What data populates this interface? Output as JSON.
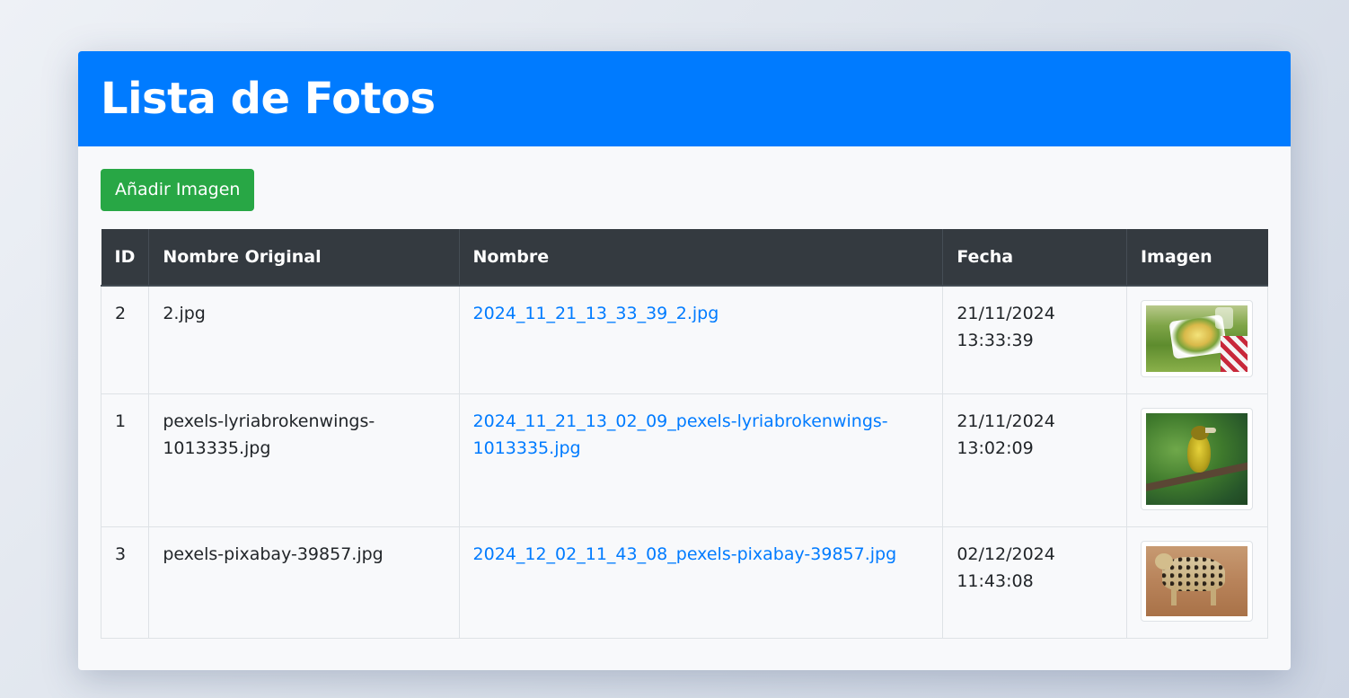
{
  "header": {
    "title": "Lista de Fotos"
  },
  "toolbar": {
    "add_label": "Añadir Imagen"
  },
  "table": {
    "headers": [
      "ID",
      "Nombre Original",
      "Nombre",
      "Fecha",
      "Imagen"
    ],
    "rows": [
      {
        "id": "2",
        "original_name": "2.jpg",
        "name": "2024_11_21_13_33_39_2.jpg",
        "date_line1": "21/11/2024",
        "date_line2": "13:33:39",
        "thumbnail": "food-photo"
      },
      {
        "id": "1",
        "original_name_line1": "pexels-lyriabrokenwings-",
        "original_name_line2": "1013335.jpg",
        "name_line1": "2024_11_21_13_02_09_pexels-lyriabrokenwings-",
        "name_line2": "1013335.jpg",
        "date_line1": "21/11/2024",
        "date_line2": "13:02:09",
        "thumbnail": "bird-photo"
      },
      {
        "id": "3",
        "original_name": "pexels-pixabay-39857.jpg",
        "name": "2024_12_02_11_43_08_pexels-pixabay-39857.jpg",
        "date_line1": "02/12/2024",
        "date_line2": "11:43:08",
        "thumbnail": "leopard-photo"
      }
    ]
  },
  "colors": {
    "header_bg": "#007bff",
    "button_bg": "#28a745",
    "table_head_bg": "#343a40",
    "link": "#007bff"
  }
}
